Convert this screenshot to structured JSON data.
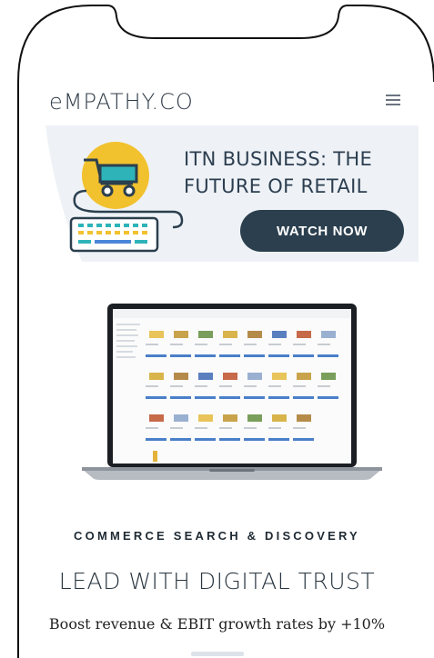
{
  "header": {
    "brand": "eMPATHY.CO",
    "menu_icon": "hamburger-menu-icon"
  },
  "banner": {
    "line1": "ITN BUSINESS: THE",
    "line2": "FUTURE OF RETAIL",
    "cta": "WATCH NOW",
    "illustration": "cart-and-keyboard-icon",
    "colors": {
      "yellow": "#f2c12e",
      "teal": "#2eb4b8",
      "navy": "#2b3f4e",
      "blue": "#4a86d9"
    }
  },
  "hero_image": "laptop-showing-product-grid",
  "section": {
    "eyebrow": "COMMERCE SEARCH & DISCOVERY",
    "headline": "LEAD WITH DIGITAL TRUST",
    "subheadline": "Boost revenue & EBIT growth rates by +10%"
  }
}
